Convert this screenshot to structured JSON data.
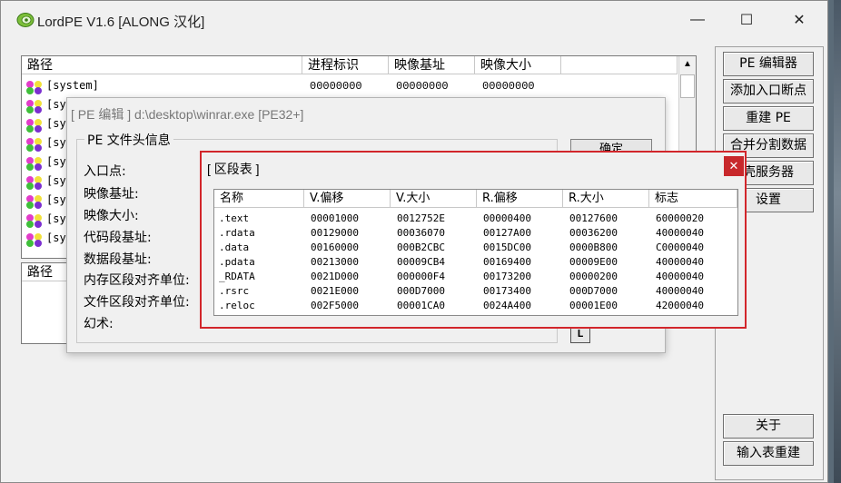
{
  "window": {
    "title": "LordPE V1.6 [ALONG 汉化]",
    "controls": {
      "minimize": "—",
      "maximize": "☐",
      "close": "✕"
    }
  },
  "process_list": {
    "columns": [
      "路径",
      "进程标识",
      "映像基址",
      "映像大小"
    ],
    "rows": [
      {
        "name": "[system]",
        "pid": "00000000",
        "base": "00000000",
        "size": "00000000"
      },
      {
        "name": "[sys"
      },
      {
        "name": "[sy"
      },
      {
        "name": "[sy"
      },
      {
        "name": "[sy"
      },
      {
        "name": "[sy"
      },
      {
        "name": "[sy"
      },
      {
        "name": "[sy"
      },
      {
        "name": "[sy"
      }
    ]
  },
  "module_list": {
    "columns": [
      "路径"
    ]
  },
  "right_buttons": {
    "pe_editor": "PE 编辑器",
    "add_break": "添加入口断点",
    "rebuild_pe": "重建 PE",
    "merge_split": "合并分割数据",
    "shell_service": "壳服务器",
    "settings": "设置",
    "about": "关于",
    "import_rebuild": "输入表重建"
  },
  "pe_editor": {
    "title": "[ PE 编辑 ] d:\\desktop\\winrar.exe [PE32+]",
    "group_label": "PE 文件头信息",
    "fields": {
      "entry_point": "入口点:",
      "image_base": "映像基址:",
      "image_size": "映像大小:",
      "code_base": "代码段基址:",
      "data_base": "数据段基址:",
      "section_alignment": "内存区段对齐单位:",
      "file_alignment": "文件区段对齐单位:",
      "magic": "幻术:"
    },
    "ok_button": "确定",
    "l_button": "L"
  },
  "section_table": {
    "title": "[ 区段表 ]",
    "close": "✕",
    "columns": [
      "名称",
      "V.偏移",
      "V.大小",
      "R.偏移",
      "R.大小",
      "标志"
    ],
    "rows": [
      [
        ".text",
        "00001000",
        "0012752E",
        "00000400",
        "00127600",
        "60000020"
      ],
      [
        ".rdata",
        "00129000",
        "00036070",
        "00127A00",
        "00036200",
        "40000040"
      ],
      [
        ".data",
        "00160000",
        "000B2CBC",
        "0015DC00",
        "0000B800",
        "C0000040"
      ],
      [
        ".pdata",
        "00213000",
        "00009CB4",
        "00169400",
        "00009E00",
        "40000040"
      ],
      [
        "_RDATA",
        "0021D000",
        "000000F4",
        "00173200",
        "00000200",
        "40000040"
      ],
      [
        ".rsrc",
        "0021E000",
        "000D7000",
        "00173400",
        "000D7000",
        "40000040"
      ],
      [
        ".reloc",
        "002F5000",
        "00001CA0",
        "0024A400",
        "00001E00",
        "42000040"
      ]
    ]
  }
}
